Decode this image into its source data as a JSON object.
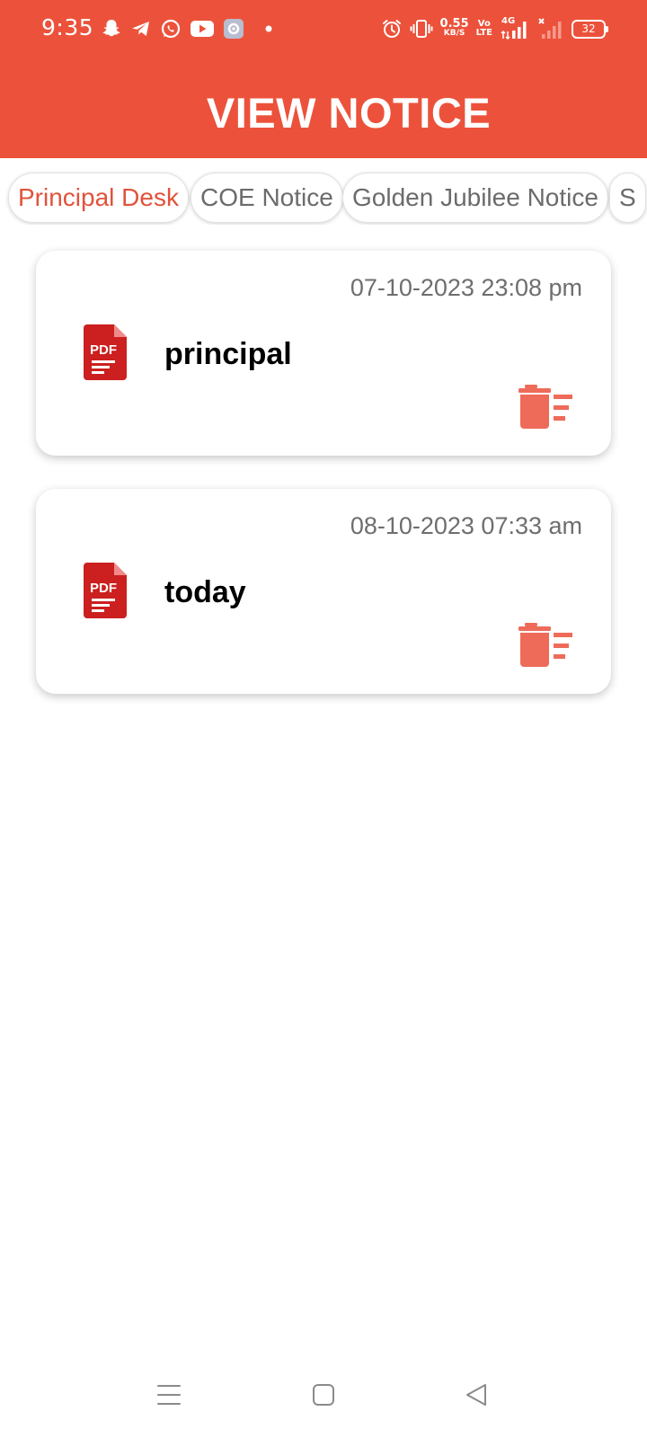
{
  "status_bar": {
    "time": "9:35",
    "net_speed_value": "0.55",
    "net_speed_unit": "KB/S",
    "volte_top": "Vo",
    "volte_bottom": "LTE",
    "network_type": "4G",
    "battery_level": "32",
    "notification_icons": [
      "snapchat-icon",
      "telegram-icon",
      "whatsapp-icon",
      "youtube-icon",
      "settings-app-icon",
      "dot-icon"
    ],
    "system_icons": [
      "alarm-icon",
      "vibrate-icon",
      "signal-icon",
      "no-signal-icon",
      "battery-icon"
    ]
  },
  "header": {
    "title": "VIEW NOTICE",
    "color": "#ec523b"
  },
  "tabs": [
    {
      "label": "Principal Desk",
      "active": true
    },
    {
      "label": "COE Notice",
      "active": false
    },
    {
      "label": "Golden Jubilee Notice",
      "active": false
    },
    {
      "label": "S",
      "active": false
    }
  ],
  "notices": [
    {
      "title": "principal",
      "date": "07-10-2023 23:08 pm",
      "file_badge": "PDF"
    },
    {
      "title": "today",
      "date": "08-10-2023 07:33 am",
      "file_badge": "PDF"
    }
  ],
  "colors": {
    "accent": "#ec523b",
    "active_tab_text": "#e0533b",
    "pdf_red": "#cc1f1f",
    "delete_icon": "#ee6b5a"
  },
  "nav_bar": {
    "icons": [
      "menu-icon",
      "home-square-icon",
      "back-triangle-icon"
    ]
  }
}
